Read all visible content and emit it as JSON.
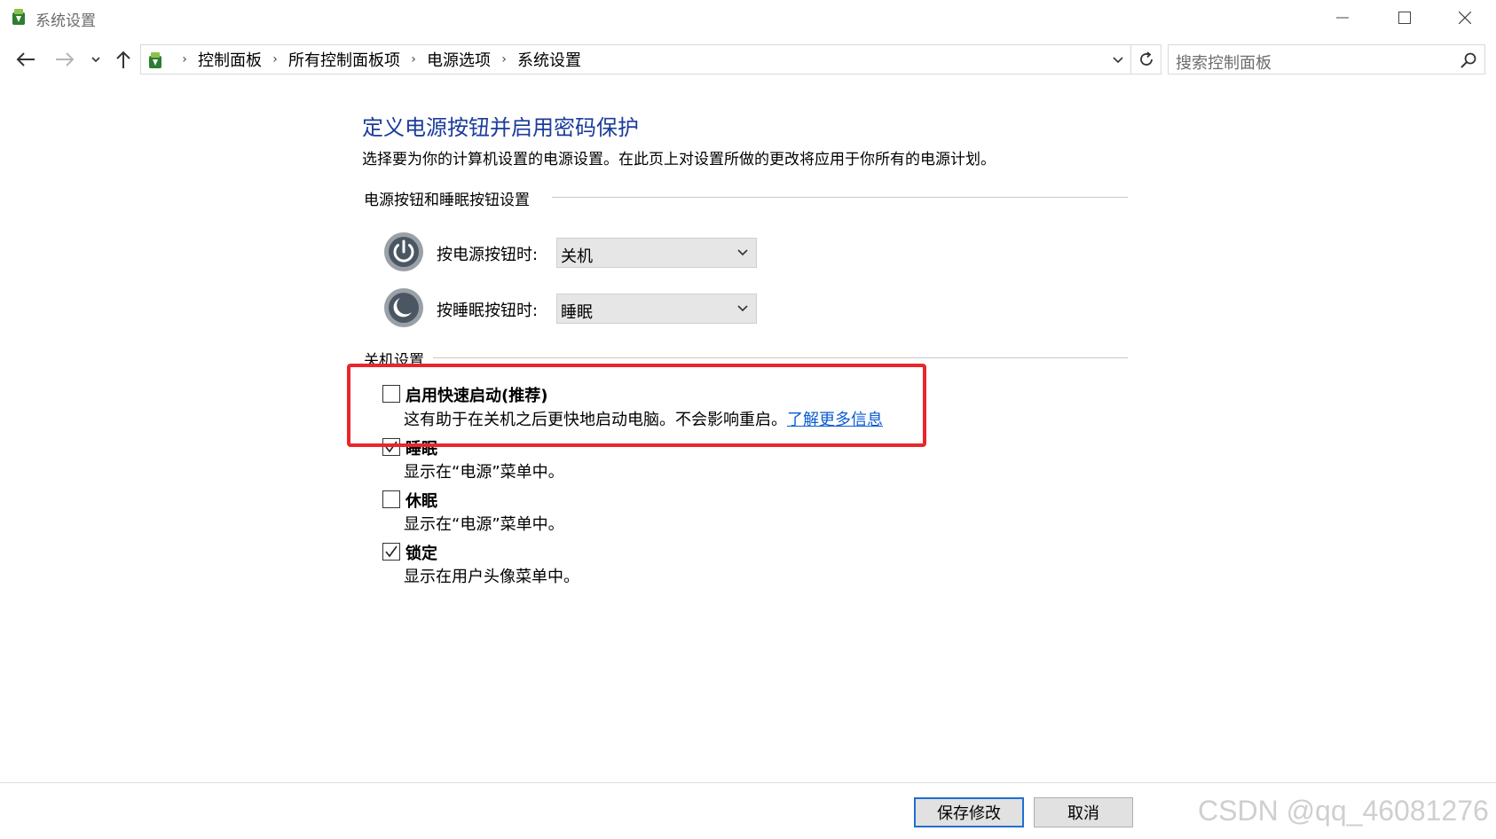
{
  "window": {
    "title": "系统设置",
    "icon": "power-options-icon"
  },
  "nav": {
    "back_icon": "arrow-left-icon",
    "forward_icon": "arrow-right-icon",
    "recent_icon": "chevron-down-icon",
    "up_icon": "arrow-up-icon"
  },
  "breadcrumb": {
    "items": [
      "控制面板",
      "所有控制面板项",
      "电源选项",
      "系统设置"
    ],
    "separator": "›"
  },
  "search": {
    "placeholder": "搜索控制面板"
  },
  "main": {
    "title": "定义电源按钮并启用密码保护",
    "description": "选择要为你的计算机设置的电源设置。在此页上对设置所做的更改将应用于你所有的电源计划。",
    "power_group": {
      "heading": "电源按钮和睡眠按钮设置",
      "rows": [
        {
          "label": "按电源按钮时:",
          "value": "关机",
          "icon": "power-icon"
        },
        {
          "label": "按睡眠按钮时:",
          "value": "睡眠",
          "icon": "sleep-icon"
        }
      ]
    },
    "shutdown_group": {
      "heading": "关机设置",
      "options": [
        {
          "title": "启用快速启动(推荐)",
          "desc": "这有助于在关机之后更快地启动电脑。不会影响重启。",
          "link": "了解更多信息",
          "checked": false
        },
        {
          "title": "睡眠",
          "desc": "显示在“电源”菜单中。",
          "checked": true
        },
        {
          "title": "休眠",
          "desc": "显示在“电源”菜单中。",
          "checked": false
        },
        {
          "title": "锁定",
          "desc": "显示在用户头像菜单中。",
          "checked": true
        }
      ]
    }
  },
  "footer": {
    "save_label": "保存修改",
    "cancel_label": "取消"
  },
  "watermark": "CSDN @qq_46081276",
  "colors": {
    "title_blue": "#1a3c9b",
    "link_blue": "#0b5bd3",
    "highlight_red": "#e8262b",
    "primary_border": "#1f6fd0"
  }
}
